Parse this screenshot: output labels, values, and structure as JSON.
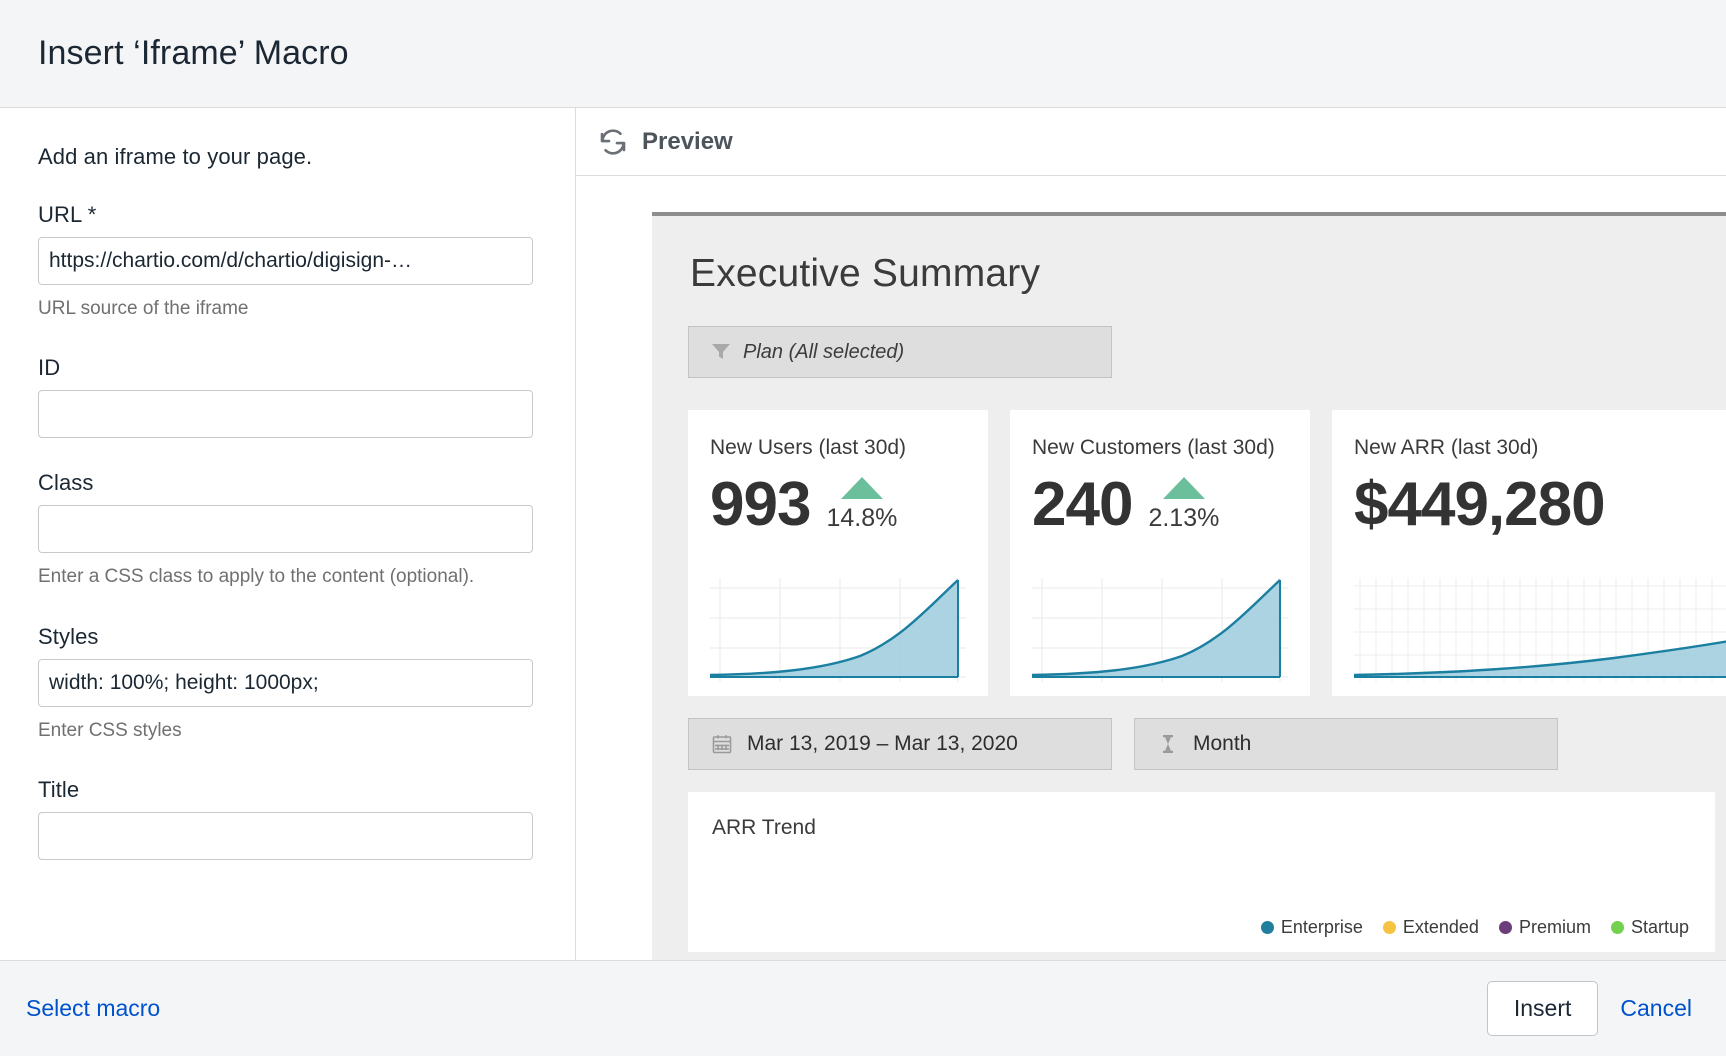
{
  "dialog": {
    "title": "Insert ‘Iframe’ Macro"
  },
  "form": {
    "intro": "Add an iframe to your page.",
    "fields": [
      {
        "label": "URL *",
        "value": "https://chartio.com/d/chartio/digisign-…",
        "help": "URL source of the iframe",
        "name": "url"
      },
      {
        "label": "ID",
        "value": "",
        "help": "",
        "name": "id"
      },
      {
        "label": "Class",
        "value": "",
        "help": "Enter a CSS class to apply to the content (optional).",
        "name": "class"
      },
      {
        "label": "Styles",
        "value": "width: 100%; height: 1000px;",
        "help": "Enter CSS styles",
        "name": "styles"
      },
      {
        "label": "Title",
        "value": "",
        "help": "",
        "name": "title"
      }
    ]
  },
  "preview": {
    "label": "Preview",
    "refresh_icon": "refresh-icon"
  },
  "dashboard": {
    "title": "Executive Summary",
    "filter": {
      "icon": "funnel-icon",
      "text": "Plan (All selected)"
    },
    "kpis": [
      {
        "title": "New Users (last 30d)",
        "value": "993",
        "delta": "14.8%",
        "direction": "up",
        "delta_color": "#6cbf9b"
      },
      {
        "title": "New Customers (last 30d)",
        "value": "240",
        "delta": "2.13%",
        "direction": "up",
        "delta_color": "#6cbf9b"
      },
      {
        "title": "New ARR (last 30d)",
        "value": "$449,280",
        "delta": "",
        "direction": "up",
        "delta_color": "#6cbf9b"
      }
    ],
    "selectors": [
      {
        "icon": "calendar-icon",
        "text": "Mar 13, 2019  –  Mar 13, 2020",
        "name": "date-range"
      },
      {
        "icon": "hourglass-icon",
        "text": "Month",
        "name": "granularity"
      }
    ],
    "trend": {
      "title": "ARR Trend",
      "legend": [
        {
          "label": "Enterprise",
          "color": "#1f7f9c"
        },
        {
          "label": "Extended",
          "color": "#f5c council"
        },
        {
          "label": "Premium",
          "color": "#6b3d7a"
        },
        {
          "label": "Startup",
          "color": "#72d14f"
        }
      ]
    },
    "spark_color_line": "#1a7fa0",
    "spark_color_fill": "#9ecbdd"
  },
  "footer": {
    "select_macro": "Select macro",
    "insert": "Insert",
    "cancel": "Cancel"
  },
  "chart_data": [
    {
      "type": "area",
      "title": "New Users (last 30d)",
      "x": [
        0,
        1,
        2,
        3,
        4,
        5,
        6,
        7,
        8,
        9,
        10,
        11,
        12
      ],
      "values": [
        2,
        2.5,
        3,
        4,
        5,
        7,
        9,
        13,
        19,
        28,
        41,
        60,
        88
      ],
      "ylim": [
        0,
        100
      ],
      "grid": true,
      "xlabel": "",
      "ylabel": ""
    },
    {
      "type": "area",
      "title": "New Customers (last 30d)",
      "x": [
        0,
        1,
        2,
        3,
        4,
        5,
        6,
        7,
        8,
        9,
        10,
        11,
        12
      ],
      "values": [
        2,
        2.5,
        3,
        4,
        5,
        7,
        9,
        13,
        19,
        28,
        41,
        60,
        88
      ],
      "ylim": [
        0,
        100
      ],
      "grid": true,
      "xlabel": "",
      "ylabel": ""
    },
    {
      "type": "area",
      "title": "New ARR (last 30d)",
      "x": [
        0,
        1,
        2,
        3,
        4,
        5,
        6,
        7,
        8,
        9,
        10,
        11,
        12
      ],
      "values": [
        1,
        1.3,
        1.7,
        2.2,
        3,
        4,
        5.5,
        7.5,
        10,
        14,
        19,
        26,
        35
      ],
      "ylim": [
        0,
        100
      ],
      "grid": true,
      "xlabel": "",
      "ylabel": ""
    },
    {
      "type": "line",
      "title": "ARR Trend",
      "legend_position": "bottom-right",
      "series": [
        {
          "name": "Enterprise",
          "color": "#1f7f9c",
          "values": []
        },
        {
          "name": "Extended",
          "color": "#f5c242",
          "values": []
        },
        {
          "name": "Premium",
          "color": "#6b3d7a",
          "values": []
        },
        {
          "name": "Startup",
          "color": "#72d14f",
          "values": []
        }
      ],
      "x": [],
      "xlabel": "",
      "ylabel": ""
    }
  ]
}
